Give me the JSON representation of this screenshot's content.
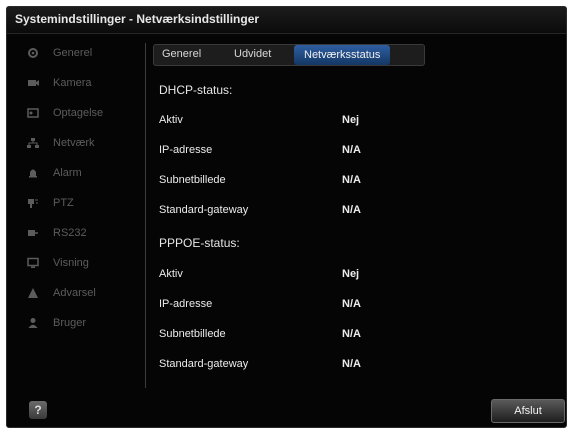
{
  "window": {
    "title": "Systemindstillinger - Netværksindstillinger"
  },
  "sidebar": {
    "items": [
      {
        "label": "Generel",
        "icon": "gear-icon"
      },
      {
        "label": "Kamera",
        "icon": "camera-icon"
      },
      {
        "label": "Optagelse",
        "icon": "recording-icon"
      },
      {
        "label": "Netværk",
        "icon": "network-icon"
      },
      {
        "label": "Alarm",
        "icon": "alarm-bell-icon"
      },
      {
        "label": "PTZ",
        "icon": "ptz-icon"
      },
      {
        "label": "RS232",
        "icon": "serial-port-icon"
      },
      {
        "label": "Visning",
        "icon": "monitor-icon"
      },
      {
        "label": "Advarsel",
        "icon": "warning-icon"
      },
      {
        "label": "Bruger",
        "icon": "user-icon"
      }
    ]
  },
  "tabs": [
    {
      "label": "Generel"
    },
    {
      "label": "Udvidet"
    },
    {
      "label": "Netværksstatus",
      "active": true
    }
  ],
  "dhcp": {
    "heading": "DHCP-status:",
    "rows": [
      {
        "label": "Aktiv",
        "value": "Nej"
      },
      {
        "label": "IP-adresse",
        "value": "N/A"
      },
      {
        "label": "Subnetbillede",
        "value": "N/A"
      },
      {
        "label": "Standard-gateway",
        "value": "N/A"
      }
    ]
  },
  "pppoe": {
    "heading": "PPPOE-status:",
    "rows": [
      {
        "label": "Aktiv",
        "value": "Nej"
      },
      {
        "label": "IP-adresse",
        "value": "N/A"
      },
      {
        "label": "Subnetbillede",
        "value": "N/A"
      },
      {
        "label": "Standard-gateway",
        "value": "N/A"
      }
    ]
  },
  "footer": {
    "help_icon": "help-icon",
    "help_glyph": "?",
    "exit_label": "Afslut"
  },
  "colors": {
    "accent": "#2e5ea0",
    "background": "#050505",
    "inactive_text": "#5c5c5c"
  }
}
